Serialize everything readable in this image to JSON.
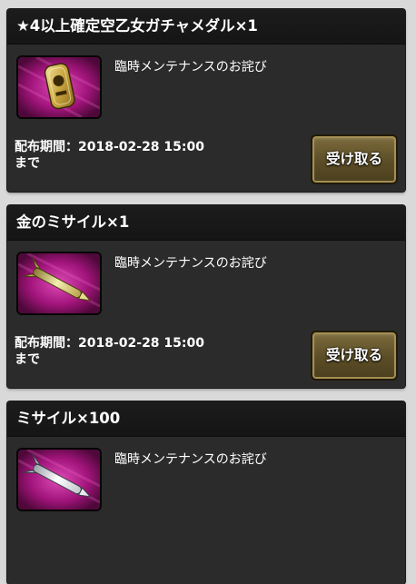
{
  "present_list": [
    {
      "title": "★4以上確定空乙女ガチャメダル×1",
      "description": "臨時メンテナンスのお詫び",
      "period_line1": "配布期間：2018-02-28 15:00",
      "period_line2": "まで",
      "button_label": "受け取る",
      "icon": "gacha-medal-icon"
    },
    {
      "title": "金のミサイル×1",
      "description": "臨時メンテナンスのお詫び",
      "period_line1": "配布期間：2018-02-28 15:00",
      "period_line2": "まで",
      "button_label": "受け取る",
      "icon": "gold-missile-icon"
    },
    {
      "title": "ミサイル×100",
      "description": "臨時メンテナンスのお詫び",
      "icon": "missile-icon"
    }
  ],
  "colors": {
    "card_background": "#2b2b2b",
    "header_background": "#1c1c1c",
    "thumbnail_magenta": "#a0147a",
    "button_gold": "#7d6c3d",
    "text": "#ffffff"
  }
}
